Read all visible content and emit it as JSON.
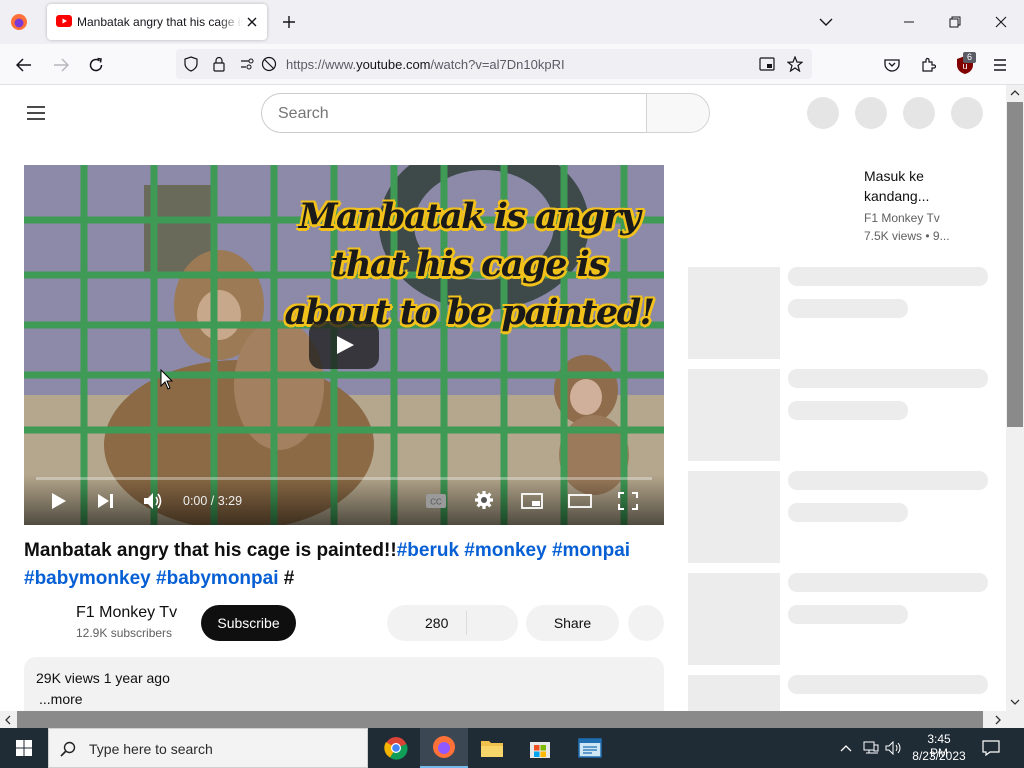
{
  "browser": {
    "tab_title": "Manbatak angry that his cage is painted!!",
    "url_prefix": "https://www.",
    "url_domain": "youtube.com",
    "url_path": "/watch?v=al7Dn10kpRI",
    "extension_badge": "6"
  },
  "youtube": {
    "search_placeholder": "Search",
    "video": {
      "overlay_text": "Manbatak is angry that his cage is about to be painted!",
      "time": "0:00 / 3:29",
      "progress": 0
    },
    "title_text": "Manbatak angry that his cage is painted!!",
    "title_tags": [
      "#beruk",
      "#monkey",
      "#monpai",
      "#babymonkey",
      "#babymonpai",
      "#"
    ],
    "channel": {
      "name": "F1 Monkey Tv",
      "subscribers": "12.9K subscribers"
    },
    "subscribe_label": "Subscribe",
    "like_count": "280",
    "share_label": "Share",
    "description": {
      "views_date": "29K views  1 year ago",
      "more": "...more"
    },
    "sidebar": {
      "first_title": "Masuk ke kandang...",
      "first_channel": "F1 Monkey Tv",
      "first_meta": "7.5K views  • 9..."
    }
  },
  "taskbar": {
    "search_placeholder": "Type here to search",
    "time": "3:45 PM",
    "date": "8/23/2023"
  }
}
